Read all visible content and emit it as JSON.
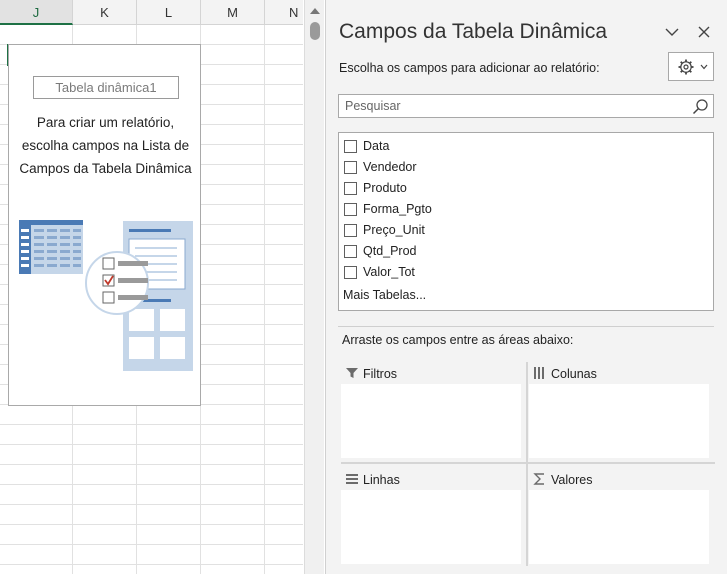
{
  "sheet": {
    "columns": [
      "J",
      "K",
      "L",
      "M",
      "N"
    ],
    "pivot_name": "Tabela dinâmica1",
    "instructions": [
      "Para criar um relatório,",
      "escolha campos na Lista de",
      "Campos da Tabela Dinâmica"
    ]
  },
  "pane": {
    "title": "Campos da Tabela Dinâmica",
    "choose_label": "Escolha os campos para adicionar ao relatório:",
    "search_placeholder": "Pesquisar",
    "fields": [
      "Data",
      "Vendedor",
      "Produto",
      "Forma_Pgto",
      "Preço_Unit",
      "Qtd_Prod",
      "Valor_Tot"
    ],
    "more_tables": "Mais Tabelas...",
    "drag_label": "Arraste os campos entre as áreas abaixo:",
    "areas": {
      "filters": "Filtros",
      "columns": "Colunas",
      "rows": "Linhas",
      "values": "Valores"
    }
  },
  "colors": {
    "excel_green": "#1e7145",
    "illustration_blue": "#4a7ab5",
    "illustration_light": "#c5d6e9",
    "check_red": "#c0392b"
  }
}
